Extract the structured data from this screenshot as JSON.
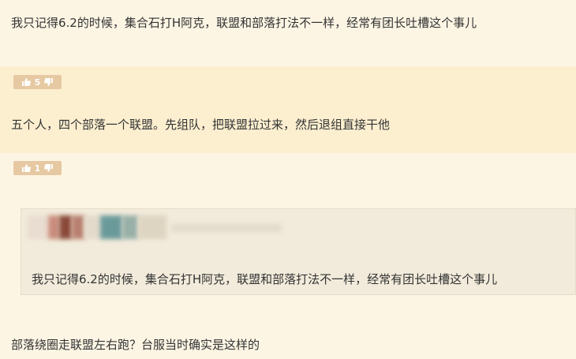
{
  "thread": {
    "post1": {
      "text": "我只记得6.2的时候，集合石打H阿克，联盟和部落打法不一样，经常有团长吐槽这个事儿"
    },
    "post2": {
      "likes": "5",
      "text": "五个人，四个部落一个联盟。先组队，把联盟拉过来，然后退组直接干他"
    },
    "post3": {
      "likes": "1",
      "quote": {
        "author_blurred": true,
        "text": "我只记得6.2的时候，集合石打H阿克，联盟和部落打法不一样，经常有团长吐槽这个事儿"
      },
      "text": "部落绕圈走联盟左右跑？台服当时确实是这样的"
    }
  },
  "icons": {
    "like": "thumbs-up-icon",
    "dislike": "thumbs-down-icon"
  },
  "colors": {
    "page_bg": "#fdf5e4",
    "highlight_bg": "#fcefd0",
    "vote_bg": "#e6c9a2",
    "quote_bg": "#f2ebdb"
  }
}
